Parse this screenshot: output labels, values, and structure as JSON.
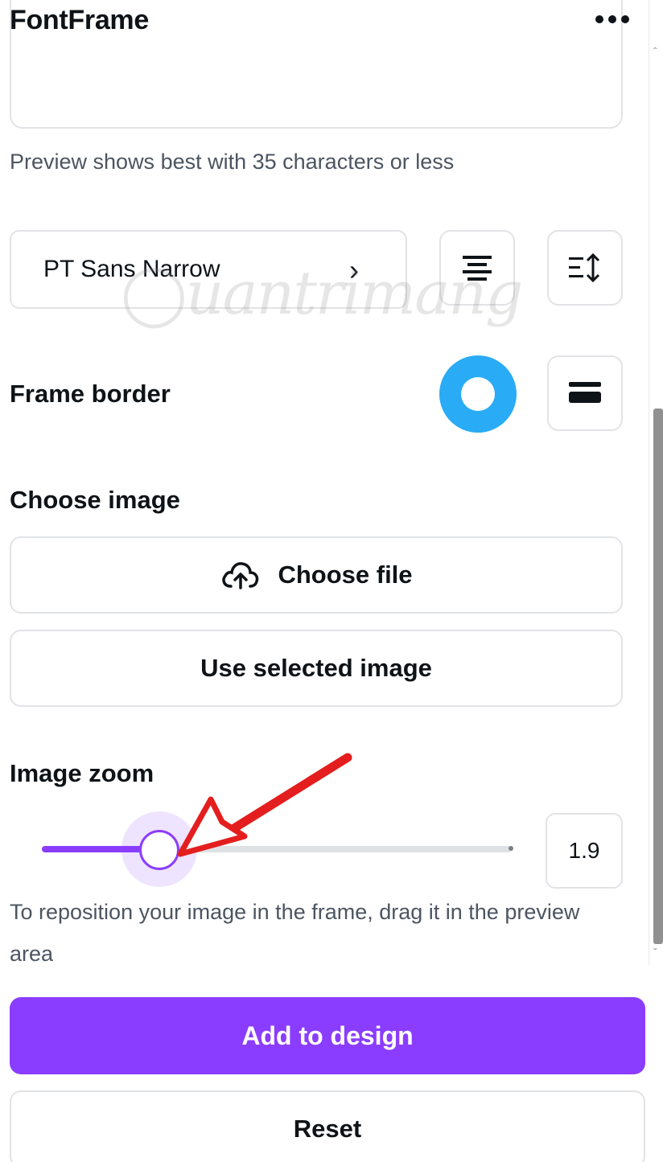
{
  "header": {
    "title": "FontFrame",
    "more_icon": "more-horizontal-icon"
  },
  "text_input": {
    "value": "",
    "hint": "Preview shows best with 35 characters or less"
  },
  "font": {
    "selected": "PT Sans Narrow",
    "chevron_icon": "chevron-right-icon",
    "align_icon": "align-center-icon",
    "spacing_icon": "line-spacing-icon"
  },
  "watermark": "Quantrimang",
  "frame_border": {
    "label": "Frame border",
    "color": "#2aabf5",
    "style_icon": "border-weight-icon"
  },
  "choose_image": {
    "label": "Choose image",
    "choose_file_label": "Choose file",
    "choose_file_icon": "cloud-upload-icon",
    "use_selected_label": "Use selected image"
  },
  "image_zoom": {
    "label": "Image zoom",
    "value": "1.9",
    "fraction": 0.25,
    "help_text": "To reposition your image in the frame, drag it in the preview area"
  },
  "actions": {
    "add_label": "Add to design",
    "reset_label": "Reset"
  },
  "colors": {
    "accent": "#8b3dff",
    "border_color_swatch": "#2aabf5"
  }
}
